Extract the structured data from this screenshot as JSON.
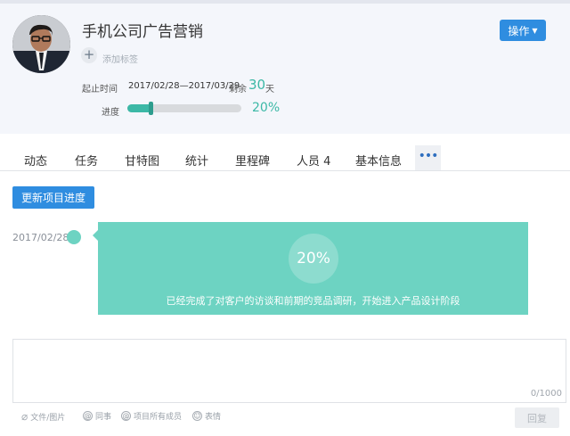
{
  "project": {
    "title": "手机公司广告营销",
    "actions_label": "操作",
    "add_tag": {
      "plus": "+",
      "label": "添加标签"
    },
    "dates": {
      "label": "起止时间",
      "range": "2017/02/28—2017/03/29",
      "remaining_label": "剩余",
      "remaining_days": "30",
      "remaining_unit": "天"
    },
    "progress": {
      "label": "进度",
      "value": 0.2,
      "value_text": "20%"
    }
  },
  "tabs": [
    {
      "label": "动态"
    },
    {
      "label": "任务"
    },
    {
      "label": "甘特图"
    },
    {
      "label": "统计"
    },
    {
      "label": "里程碑"
    },
    {
      "label": "人员 4"
    },
    {
      "label": "基本信息"
    }
  ],
  "tab_more": "•••",
  "update_button": "更新项目进度",
  "timeline": [
    {
      "date": "2017/02/28",
      "progress": "20%",
      "text": "已经完成了对客户的访谈和前期的竞品调研，开始进入产品设计阶段"
    }
  ],
  "comment": {
    "char_count": "0/1000",
    "toolbar": {
      "files": "文件/图片",
      "colleague": "同事",
      "all_members": "项目所有成员",
      "emoji": "表情"
    },
    "publish": "回复"
  },
  "colors": {
    "accent": "#3cb8a6",
    "card": "#6dd3c2",
    "primary": "#2f8de0"
  }
}
